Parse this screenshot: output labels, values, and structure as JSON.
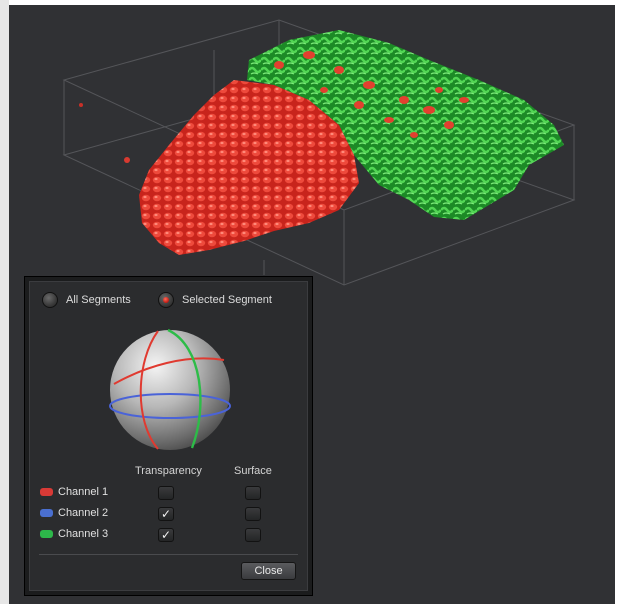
{
  "view": {
    "volume_colors": {
      "channel1": "#e23a2e",
      "channel3": "#34b83a"
    }
  },
  "dialog": {
    "mode_options": [
      {
        "label": "All Segments",
        "selected": false
      },
      {
        "label": "Selected Segment",
        "selected": true
      }
    ],
    "orientation_widget": {
      "icon": "orientation-sphere-icon"
    },
    "columns": {
      "transparency": "Transparency",
      "surface": "Surface"
    },
    "channels": [
      {
        "label": "Channel 1",
        "color": "#d83a36",
        "transparency": false,
        "surface": false
      },
      {
        "label": "Channel 2",
        "color": "#4a6fd0",
        "transparency": true,
        "surface": false
      },
      {
        "label": "Channel 3",
        "color": "#2db84a",
        "transparency": true,
        "surface": false
      }
    ],
    "check_glyph": "✓",
    "close_label": "Close"
  }
}
